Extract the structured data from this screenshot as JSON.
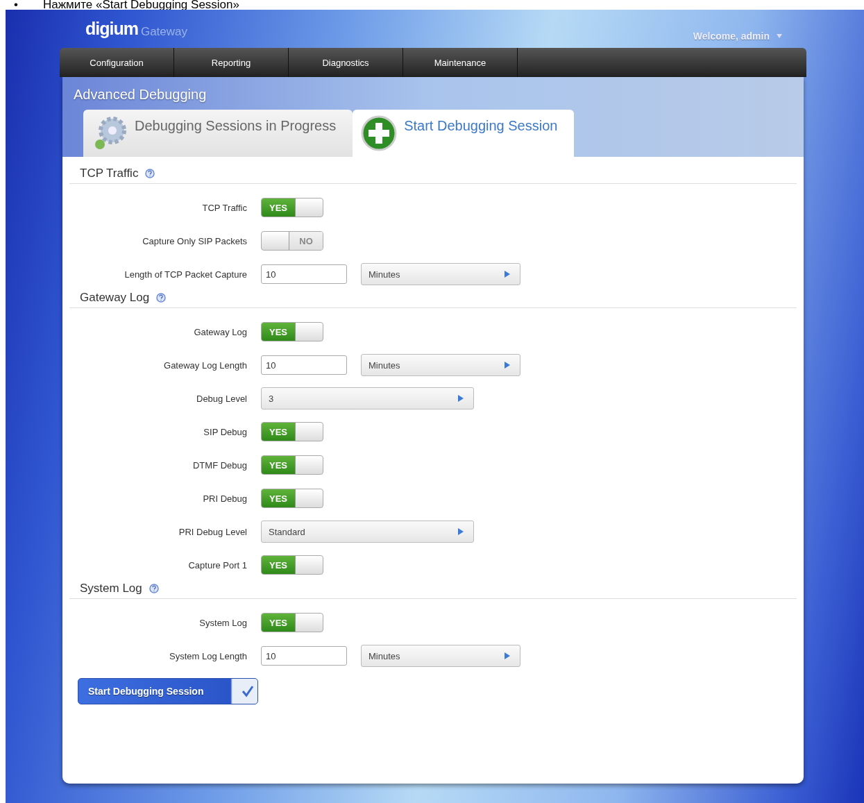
{
  "caption": {
    "bullet": "•",
    "text": "Нажмите «Start Debugging Session»"
  },
  "header": {
    "logo": "digium",
    "product": "Gateway",
    "user_menu": "Welcome, admin"
  },
  "nav": [
    {
      "label": "Configuration"
    },
    {
      "label": "Reporting"
    },
    {
      "label": "Diagnostics"
    },
    {
      "label": "Maintenance"
    }
  ],
  "page_title": "Advanced Debugging",
  "tabs": [
    {
      "label": "Debugging Sessions in Progress",
      "kind": "gear",
      "selected": false
    },
    {
      "label": "Start Debugging Session",
      "kind": "plus",
      "selected": true
    }
  ],
  "sections": [
    {
      "title": "TCP Traffic",
      "rows": [
        {
          "kind": "toggle",
          "label": "TCP Traffic",
          "on": true,
          "text": "YES"
        },
        {
          "kind": "toggle",
          "label": "Capture Only SIP Packets",
          "on": false,
          "text": "NO"
        },
        {
          "kind": "duration",
          "label": "Length of TCP Packet Capture",
          "value": "10",
          "unit": "Minutes"
        }
      ]
    },
    {
      "title": "Gateway Log",
      "rows": [
        {
          "kind": "toggle",
          "label": "Gateway Log",
          "on": true,
          "text": "YES"
        },
        {
          "kind": "duration",
          "label": "Gateway Log Length",
          "value": "10",
          "unit": "Minutes"
        },
        {
          "kind": "select",
          "label": "Debug Level",
          "value": "3"
        },
        {
          "kind": "toggle",
          "label": "SIP Debug",
          "on": true,
          "text": "YES"
        },
        {
          "kind": "toggle",
          "label": "DTMF Debug",
          "on": true,
          "text": "YES"
        },
        {
          "kind": "toggle",
          "label": "PRI Debug",
          "on": true,
          "text": "YES"
        },
        {
          "kind": "select",
          "label": "PRI Debug Level",
          "value": "Standard"
        },
        {
          "kind": "toggle",
          "label": "Capture Port 1",
          "on": true,
          "text": "YES"
        }
      ]
    },
    {
      "title": "System Log",
      "rows": [
        {
          "kind": "toggle",
          "label": "System Log",
          "on": true,
          "text": "YES"
        },
        {
          "kind": "duration",
          "label": "System Log Length",
          "value": "10",
          "unit": "Minutes"
        }
      ]
    }
  ],
  "submit": "Start Debugging Session"
}
